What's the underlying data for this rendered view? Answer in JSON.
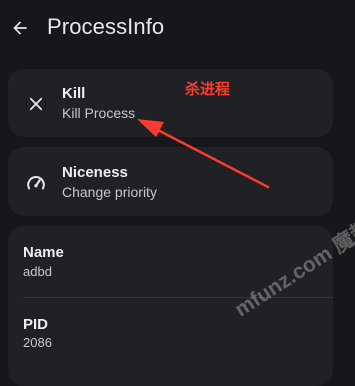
{
  "appbar": {
    "title": "ProcessInfo",
    "back_icon": "back-arrow-icon"
  },
  "actions": [
    {
      "icon": "close-icon",
      "title": "Kill",
      "subtitle": "Kill Process"
    },
    {
      "icon": "gauge-icon",
      "title": "Niceness",
      "subtitle": "Change priority"
    }
  ],
  "info": [
    {
      "label": "Name",
      "value": "adbd"
    },
    {
      "label": "PID",
      "value": "2086"
    }
  ],
  "annotation": {
    "text": "杀进程",
    "color": "#ff3b30"
  },
  "watermark": {
    "text": "mfunz.com 魔趣网"
  },
  "colors": {
    "background": "#16171b",
    "card": "#1f2125"
  }
}
